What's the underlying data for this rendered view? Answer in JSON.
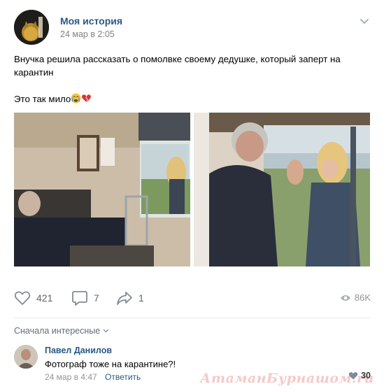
{
  "post": {
    "author": "Моя история",
    "date": "24 мар в 2:05",
    "text_line1": "Внучка решила рассказать о помолвке своему дедушке, который заперт на",
    "text_line2": "карантин",
    "text_line3": "Это так мило",
    "emojis": [
      "crying-face",
      "broken-heart"
    ]
  },
  "actions": {
    "likes": "421",
    "comments": "7",
    "shares": "1",
    "views": "86K"
  },
  "comments": {
    "sort_label": "Сначала интересные",
    "items": [
      {
        "author": "Павел Данилов",
        "text": "Фотограф тоже на карантине?!",
        "date": "24 мар в 4:47",
        "reply_label": "Ответить",
        "likes": "30"
      }
    ]
  },
  "watermark": "АтаманБурнашом.ru",
  "colors": {
    "link": "#2a5885",
    "muted": "#828282",
    "divider": "#e7e8ec"
  }
}
